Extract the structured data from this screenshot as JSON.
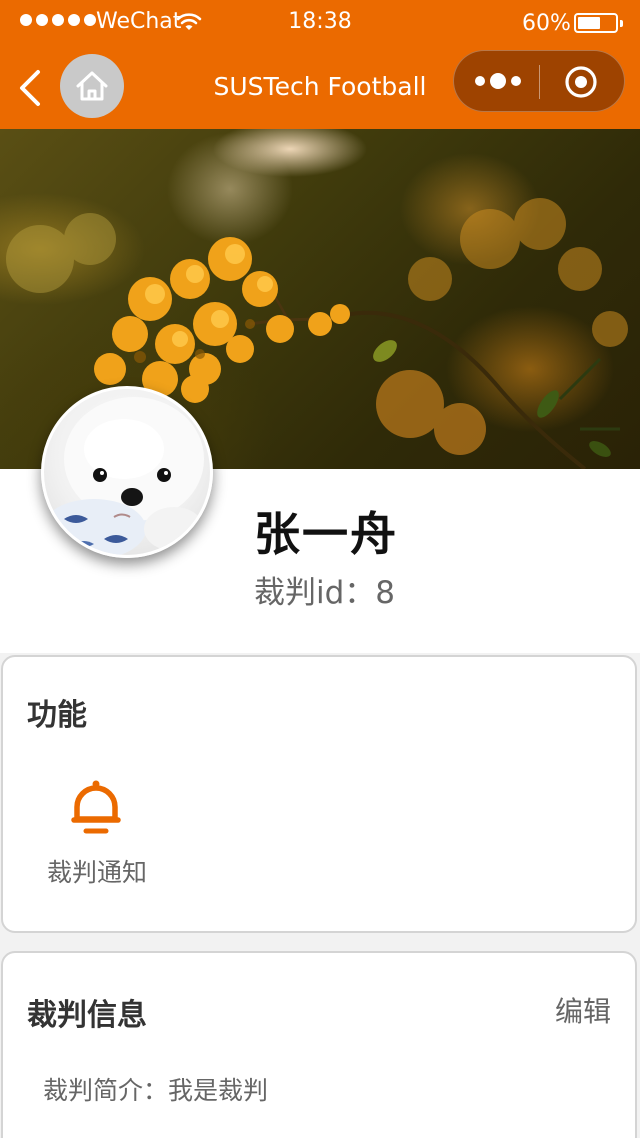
{
  "status_bar": {
    "carrier": "WeChat",
    "time": "18:38",
    "battery": "60%",
    "battery_level": 0.6
  },
  "nav": {
    "title": "SUSTech Football",
    "back_icon": "chevron-left-icon",
    "home_icon": "home-icon",
    "more_icon": "more-dots-icon",
    "close_icon": "target-close-icon"
  },
  "colors": {
    "accent": "#eb6a00",
    "capsule": "#9e4300",
    "card_border": "#d4d4d4",
    "page_bg": "#f2f2f2"
  },
  "profile": {
    "name": "张一舟",
    "id_label": "裁判id：8"
  },
  "functions": {
    "title": "功能",
    "items": [
      {
        "label": "裁判通知",
        "icon": "bell-icon"
      }
    ]
  },
  "referee_info": {
    "title": "裁判信息",
    "edit_label": "编辑",
    "intro": "裁判简介：我是裁判"
  }
}
